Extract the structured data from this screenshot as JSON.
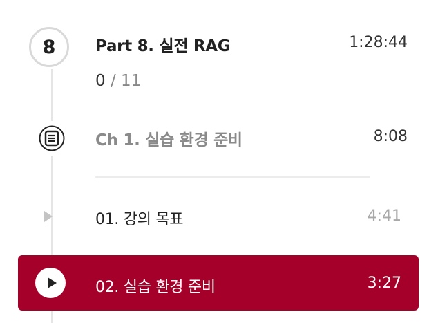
{
  "part": {
    "number": "8",
    "title": "Part 8. 실전 RAG",
    "duration": "1:28:44",
    "progress_done": "0",
    "progress_separator": "/",
    "progress_total": "11"
  },
  "chapter": {
    "icon": "document-list-icon",
    "title": "Ch 1. 실습 환경 준비",
    "duration": "8:08"
  },
  "lessons": [
    {
      "icon": "play-triangle-icon",
      "title": "01. 강의 목표",
      "duration": "4:41",
      "active": false
    },
    {
      "icon": "play-circle-icon",
      "title": "02. 실습 환경 준비",
      "duration": "3:27",
      "active": true
    }
  ],
  "colors": {
    "active_background": "#a5002a",
    "muted_text": "#8a8a8a",
    "timeline": "#e5e5e5"
  }
}
